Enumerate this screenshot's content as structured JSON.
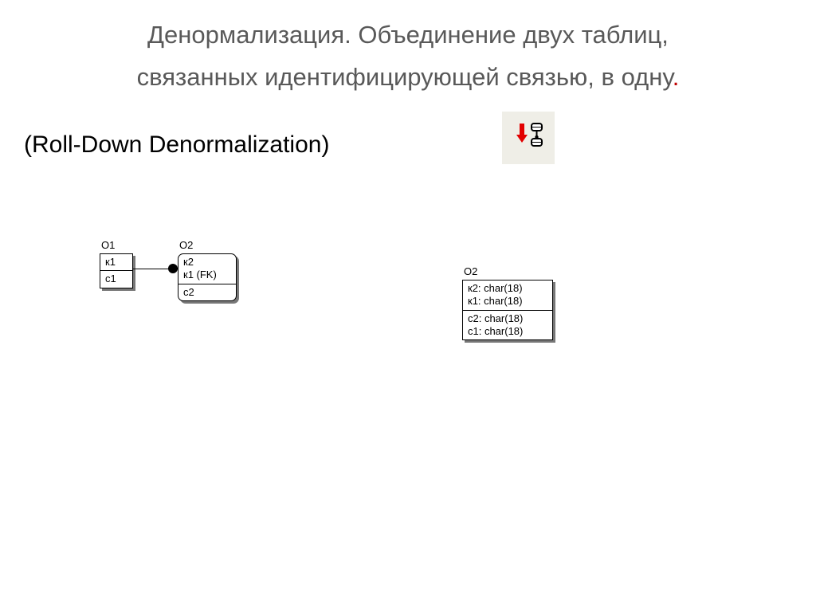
{
  "title_line1": "Денормализация. Объединение двух таблиц,",
  "title_line2": "связанных идентифицирующей связью, в одну",
  "title_dot": ".",
  "subtitle": "(Roll-Down Denormalization)",
  "left": {
    "e1": {
      "name": "О1",
      "top": "к1",
      "bottom": "с1"
    },
    "e2": {
      "name": "О2",
      "top": "к2\nк1 (FK)",
      "bottom": "с2"
    }
  },
  "right": {
    "e": {
      "name": "О2",
      "top": "к2: char(18)\nк1: char(18)",
      "bottom": "с2: char(18)\nс1: char(18)"
    }
  }
}
